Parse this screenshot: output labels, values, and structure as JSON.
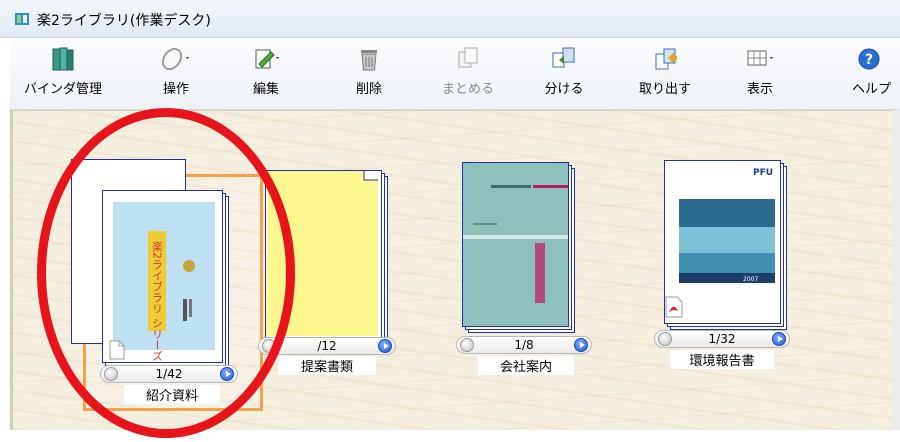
{
  "window": {
    "title": "楽2ライブラリ(作業デスク)"
  },
  "toolbar": {
    "items": [
      {
        "label": "バインダ管理",
        "icon": "binder-manage-icon",
        "disabled": false
      },
      {
        "label": "操作",
        "icon": "pen-operation-icon",
        "disabled": false
      },
      {
        "label": "編集",
        "icon": "edit-icon",
        "disabled": false
      },
      {
        "label": "削除",
        "icon": "trash-icon",
        "disabled": false
      },
      {
        "label": "まとめる",
        "icon": "merge-icon",
        "disabled": true
      },
      {
        "label": "分ける",
        "icon": "split-icon",
        "disabled": false
      },
      {
        "label": "取り出す",
        "icon": "extract-icon",
        "disabled": false
      },
      {
        "label": "表示",
        "icon": "view-icon",
        "disabled": false
      },
      {
        "label": "ヘルプ",
        "icon": "help-icon",
        "disabled": false
      }
    ]
  },
  "binders": [
    {
      "name": "紹介資料",
      "count": "1/42",
      "selected": true
    },
    {
      "name": "提案書類",
      "count": "/12",
      "selected": false
    },
    {
      "name": "会社案内",
      "count": "1/8",
      "selected": false
    },
    {
      "name": "環境報告書",
      "count": "1/32",
      "selected": false
    }
  ],
  "thumbnails": {
    "brochure_vertical_text": "楽2ライブラリ シリーズ",
    "report_logo": "PFU",
    "report_year": "2007"
  },
  "colors": {
    "selection_orange": "#f4a14a",
    "annotation_red": "#e8141c",
    "page_border_blue": "#1c2fb4"
  }
}
